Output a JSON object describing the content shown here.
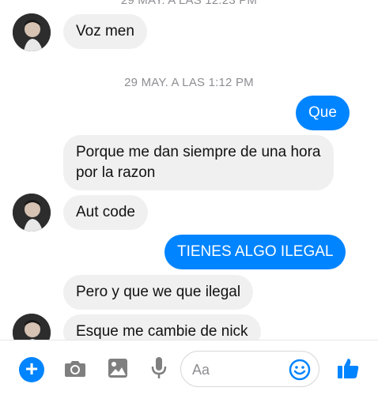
{
  "timestamps": {
    "top": "29 MAY. A LAS 12:23 PM",
    "middle": "29 MAY. A LAS 1:12 PM"
  },
  "messages": [
    {
      "text": "Voz men",
      "direction": "incoming"
    },
    {
      "text": "Que",
      "direction": "outgoing"
    },
    {
      "text": "Porque me dan siempre de una hora por la razon",
      "direction": "incoming"
    },
    {
      "text": "Aut code",
      "direction": "incoming"
    },
    {
      "text": "TIENES ALGO ILEGAL",
      "direction": "outgoing"
    },
    {
      "text": "Pero y que we que ilegal",
      "direction": "incoming"
    },
    {
      "text": "Esque me cambie de nick",
      "direction": "incoming"
    }
  ],
  "composer": {
    "placeholder": "Aa",
    "icons": [
      "plus-icon",
      "camera-icon",
      "image-icon",
      "microphone-icon",
      "emoji-icon",
      "thumbs-up-icon"
    ]
  },
  "colors": {
    "accent": "#0084ff",
    "incoming_bubble": "#f1f0f0",
    "timestamp": "#8e8e93"
  }
}
